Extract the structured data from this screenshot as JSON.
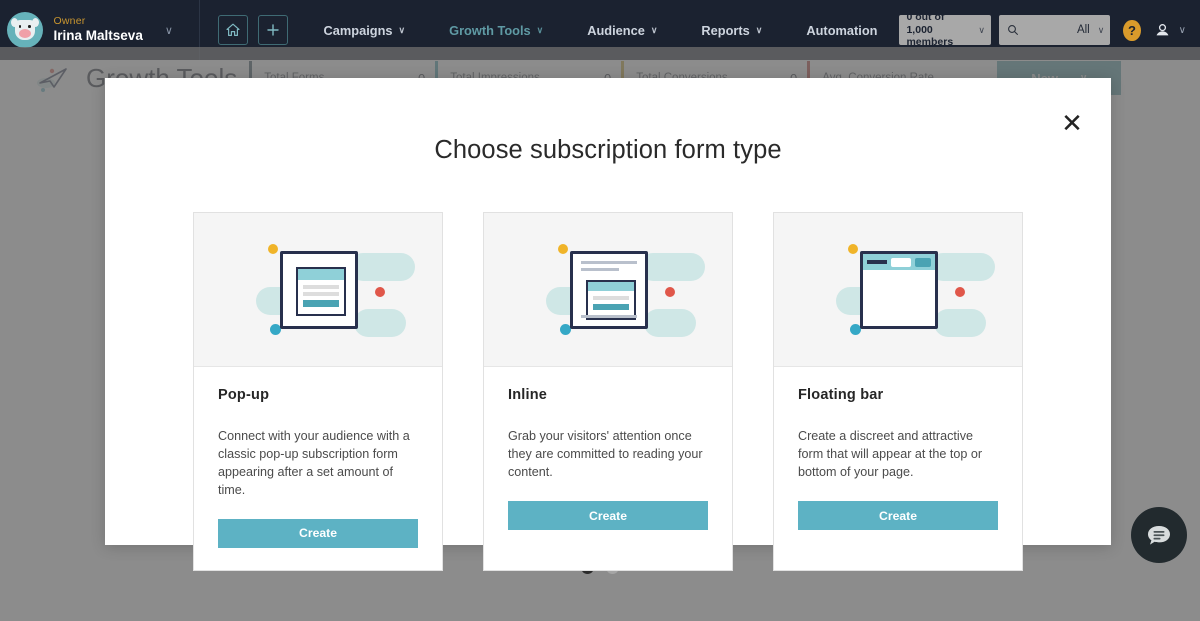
{
  "topnav": {
    "account": {
      "role": "Owner",
      "name": "Irina Maltseva",
      "caret": "∨",
      "avatar_icon": "pig-avatar-icon"
    },
    "home_icon": "home-icon",
    "add_icon": "plus-icon",
    "links": [
      {
        "label": "Campaigns",
        "caret": "∨",
        "active": false
      },
      {
        "label": "Growth Tools",
        "caret": "∨",
        "active": true
      },
      {
        "label": "Audience",
        "caret": "∨",
        "active": false
      },
      {
        "label": "Reports",
        "caret": "∨",
        "active": false
      },
      {
        "label": "Automation",
        "caret": "",
        "active": false
      }
    ],
    "quota": {
      "line1": "0 out of",
      "line2": "1,000 members",
      "caret": "∨"
    },
    "search": {
      "icon": "search-icon",
      "placeholder": "",
      "value": "",
      "scope": "All",
      "caret": "∨"
    },
    "help_label": "?",
    "user_icon": "user-icon",
    "user_caret": "∨"
  },
  "page": {
    "logo_icon": "paper-plane-icon",
    "title": "Growth Tools",
    "stats": [
      {
        "label": "Total Forms",
        "value": "0",
        "color": "#2f4a57"
      },
      {
        "label": "Total Impressions",
        "value": "0",
        "color": "#3d9aa8"
      },
      {
        "label": "Total Conversions",
        "value": "0",
        "color": "#c9a227"
      },
      {
        "label": "Avg. Conversion Rate",
        "value": "-",
        "color": "#b8332a"
      }
    ],
    "new_button": {
      "label": "New",
      "caret": "∨"
    }
  },
  "modal": {
    "title": "Choose subscription form type",
    "close_icon": "close-icon",
    "cards": [
      {
        "illustration": "popup-illustration",
        "title": "Pop-up",
        "description": "Connect with your audience with a classic pop-up subscription form appearing after a set amount of time.",
        "button_label": "Create"
      },
      {
        "illustration": "inline-illustration",
        "title": "Inline",
        "description": "Grab your visitors' attention once they are committed to reading your content.",
        "button_label": "Create"
      },
      {
        "illustration": "floating-bar-illustration",
        "title": "Floating bar",
        "description": "Create a discreet and attractive form that will appear at the top or bottom of your page.",
        "button_label": "Create"
      }
    ]
  },
  "pagination": {
    "dots": [
      {
        "active": true
      },
      {
        "active": false
      }
    ]
  },
  "chat": {
    "icon": "chat-bubble-icon"
  },
  "colors": {
    "nav_bg": "#1b2230",
    "accent_teal": "#5db2c4",
    "active_link": "#5f9aa4",
    "owner_gold": "#c8952f",
    "overlay": "#6c6c6c",
    "illustration_navy": "#28304d",
    "illustration_blob": "#cfe7e6"
  }
}
